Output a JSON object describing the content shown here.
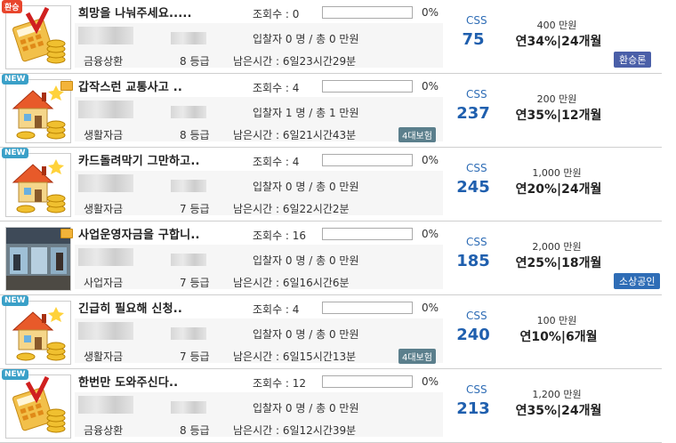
{
  "loans": [
    {
      "tag": "환승",
      "tag_kind": "hot",
      "folder": false,
      "icon": "calculator-coins-icon",
      "title": "희망을 나눠주세요.....",
      "views": "조회수 : 0",
      "pct": "0%",
      "progress": 0,
      "bid": "입찰자 0 명 / 총 0 만원",
      "type": "금융상환",
      "grade": "8 등급",
      "remain": "남은시간 : 6일23시간29분",
      "insurance": "",
      "css_label": "CSS",
      "css": "75",
      "amount": "400 만원",
      "rate": "연34%|24개월",
      "badge": "환승론",
      "badge_color": "#4a5fa8"
    },
    {
      "tag": "NEW",
      "tag_kind": "new",
      "folder": true,
      "icon": "house-coins-icon",
      "title": "갑작스런 교통사고 ..",
      "views": "조회수 : 4",
      "pct": "0%",
      "progress": 0,
      "bid": "입찰자 1 명 / 총 1 만원",
      "type": "생활자금",
      "grade": "8 등급",
      "remain": "남은시간 : 6일21시간43분",
      "insurance": "4대보험",
      "css_label": "CSS",
      "css": "237",
      "amount": "200 만원",
      "rate": "연35%|12개월",
      "badge": "",
      "badge_color": ""
    },
    {
      "tag": "NEW",
      "tag_kind": "new",
      "folder": false,
      "icon": "house-coins-icon",
      "title": "카드돌려막기 그만하고..",
      "views": "조회수 : 4",
      "pct": "0%",
      "progress": 0,
      "bid": "입찰자 0 명 / 총 0 만원",
      "type": "생활자금",
      "grade": "7 등급",
      "remain": "남은시간 : 6일22시간2분",
      "insurance": "",
      "css_label": "CSS",
      "css": "245",
      "amount": "1,000 만원",
      "rate": "연20%|24개월",
      "badge": "",
      "badge_color": ""
    },
    {
      "tag": "",
      "tag_kind": "",
      "folder": true,
      "icon": "shop-photo-icon",
      "title": "사업운영자금을 구합니..",
      "views": "조회수 : 16",
      "pct": "0%",
      "progress": 0,
      "bid": "입찰자 0 명 / 총 0 만원",
      "type": "사업자금",
      "grade": "7 등급",
      "remain": "남은시간 : 6일16시간6분",
      "insurance": "",
      "css_label": "CSS",
      "css": "185",
      "amount": "2,000 만원",
      "rate": "연25%|18개월",
      "badge": "소상공인",
      "badge_color": "#2f6db6"
    },
    {
      "tag": "NEW",
      "tag_kind": "new",
      "folder": false,
      "icon": "house-coins-icon",
      "title": "긴급히 필요해 신청..",
      "views": "조회수 : 4",
      "pct": "0%",
      "progress": 0,
      "bid": "입찰자 0 명 / 총 0 만원",
      "type": "생활자금",
      "grade": "7 등급",
      "remain": "남은시간 : 6일15시간13분",
      "insurance": "4대보험",
      "css_label": "CSS",
      "css": "240",
      "amount": "100 만원",
      "rate": "연10%|6개월",
      "badge": "",
      "badge_color": ""
    },
    {
      "tag": "NEW",
      "tag_kind": "new",
      "folder": false,
      "icon": "calculator-coins-icon",
      "title": "한번만 도와주신다..",
      "views": "조회수 : 12",
      "pct": "0%",
      "progress": 0,
      "bid": "입찰자 0 명 / 총 0 만원",
      "type": "금융상환",
      "grade": "8 등급",
      "remain": "남은시간 : 6일12시간39분",
      "insurance": "",
      "css_label": "CSS",
      "css": "213",
      "amount": "1,200 만원",
      "rate": "연35%|24개월",
      "badge": "",
      "badge_color": ""
    }
  ]
}
